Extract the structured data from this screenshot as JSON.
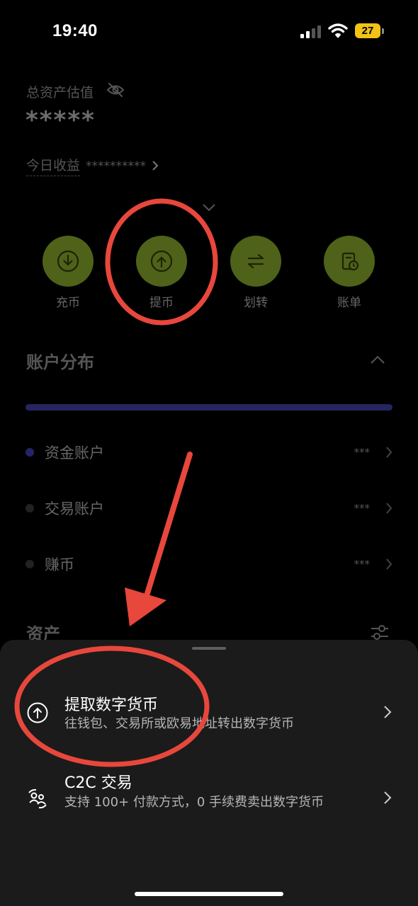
{
  "status_bar": {
    "time": "19:40",
    "battery": "27"
  },
  "overview": {
    "total_label": "总资产估值",
    "total_value": "*****",
    "profit_label": "今日收益",
    "profit_value": "**********"
  },
  "actions": [
    {
      "label": "充币",
      "icon": "deposit-icon"
    },
    {
      "label": "提币",
      "icon": "withdraw-icon"
    },
    {
      "label": "划转",
      "icon": "transfer-icon"
    },
    {
      "label": "账单",
      "icon": "bill-icon"
    }
  ],
  "distribution": {
    "title": "账户分布",
    "accounts": [
      {
        "name": "资金账户",
        "value": "***"
      },
      {
        "name": "交易账户",
        "value": "***"
      },
      {
        "name": "赚币",
        "value": "***"
      }
    ]
  },
  "assets": {
    "title": "资产"
  },
  "sheet": {
    "items": [
      {
        "title": "提取数字货币",
        "desc": "往钱包、交易所或欧易地址转出数字货币",
        "icon": "withdraw-icon"
      },
      {
        "title": "C2C 交易",
        "desc": "支持 100+ 付款方式，0 手续费卖出数字货币",
        "icon": "c2c-trade-icon"
      }
    ]
  },
  "colors": {
    "accent_green": "#4f6219",
    "distribution_bar": "#262560",
    "annotation_red": "#e8473c",
    "battery": "#f2c316"
  }
}
